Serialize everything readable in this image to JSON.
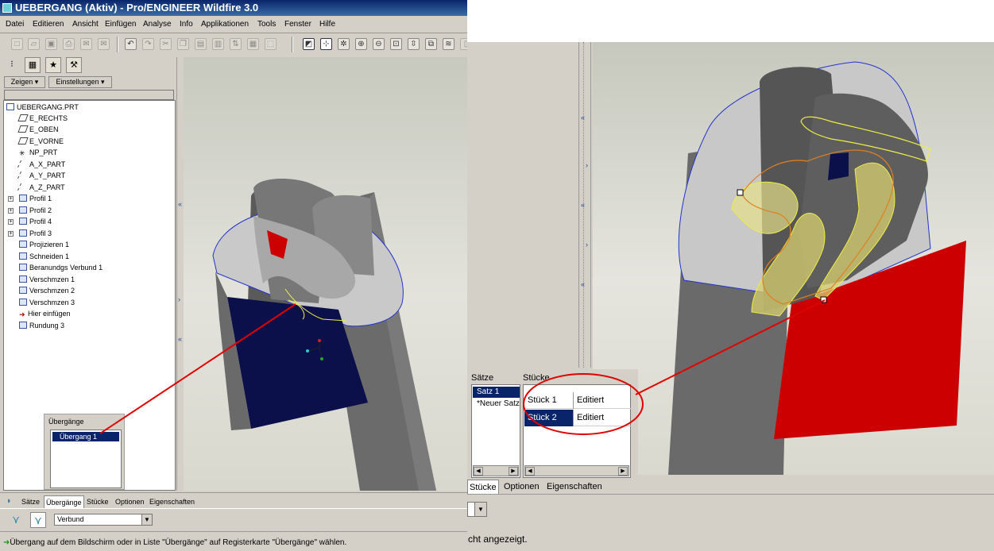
{
  "left_window": {
    "title": "UEBERGANG (Aktiv) - Pro/ENGINEER Wildfire 3.0",
    "menu": [
      "Datei",
      "Editieren",
      "Ansicht",
      "Einfügen",
      "Analyse",
      "Info",
      "Applikationen",
      "Tools",
      "Fenster",
      "Hilfe"
    ],
    "nav_dropdowns": {
      "show": "Zeigen",
      "settings": "Einstellungen"
    },
    "tree": [
      {
        "label": "UEBERGANG.PRT",
        "icon": "part-icon"
      },
      {
        "label": "E_RECHTS",
        "icon": "datum-plane-icon"
      },
      {
        "label": "E_OBEN",
        "icon": "datum-plane-icon"
      },
      {
        "label": "E_VORNE",
        "icon": "datum-plane-icon"
      },
      {
        "label": "NP_PRT",
        "icon": "coordinate-system-icon"
      },
      {
        "label": "A_X_PART",
        "icon": "datum-axis-icon"
      },
      {
        "label": "A_Y_PART",
        "icon": "datum-axis-icon"
      },
      {
        "label": "A_Z_PART",
        "icon": "datum-axis-icon"
      },
      {
        "label": "Profil 1",
        "icon": "sketch-icon",
        "expandable": true
      },
      {
        "label": "Profil 2",
        "icon": "sketch-icon",
        "expandable": true
      },
      {
        "label": "Profil 4",
        "icon": "sketch-icon",
        "expandable": true
      },
      {
        "label": "Profil 3",
        "icon": "sketch-icon",
        "expandable": true
      },
      {
        "label": "Projizieren 1",
        "icon": "projection-icon"
      },
      {
        "label": "Schneiden 1",
        "icon": "cut-icon"
      },
      {
        "label": "Beranundgs Verbund 1",
        "icon": "boundary-blend-icon"
      },
      {
        "label": "Verschmzen 1",
        "icon": "merge-icon"
      },
      {
        "label": "Verschmzen 2",
        "icon": "merge-icon"
      },
      {
        "label": "Verschmzen 3",
        "icon": "merge-icon"
      },
      {
        "label": "Hier einfügen",
        "icon": "insert-arrow-icon"
      },
      {
        "label": "Rundung 3",
        "icon": "round-icon"
      }
    ],
    "transitions_panel": {
      "title": "Übergänge",
      "items": [
        "Übergang 1"
      ],
      "selected": 0
    },
    "tabs": [
      "Sätze",
      "Übergänge",
      "Stücke",
      "Optionen",
      "Eigenschaften"
    ],
    "active_tab": "Übergänge",
    "transition_type": "Verbund",
    "status": "Übergang auf dem Bildschirm oder in Liste \"Übergänge\" auf Registerkarte \"Übergänge\" wählen."
  },
  "right_window": {
    "panel_headers": {
      "sets": "Sätze",
      "pieces": "Stücke"
    },
    "sets": [
      "Satz 1",
      "*Neuer Satz"
    ],
    "selected_set": 0,
    "pieces": [
      {
        "name": "Stück 1",
        "state": "Editiert"
      },
      {
        "name": "Stück 2",
        "state": "Editiert"
      }
    ],
    "selected_piece": 1,
    "tabs": [
      "Stücke",
      "Optionen",
      "Eigenschaften"
    ],
    "active_tab": "Stücke",
    "status": "cht angezeigt."
  },
  "colors": {
    "model_gray": "#6b6b6b",
    "cut_face_red": "#cc0000",
    "navy_face": "#0b0f4a",
    "transition_yellow": "#eeee44",
    "annotation_red": "#e00000",
    "selection_blue": "#0a246a"
  }
}
